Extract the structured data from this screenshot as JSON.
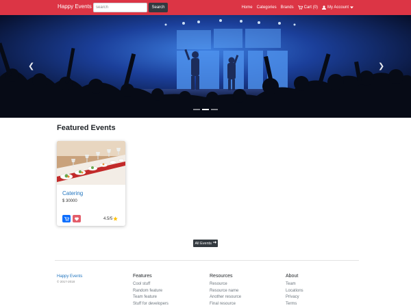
{
  "navbar": {
    "brand": "Happy Events",
    "search_placeholder": "search",
    "search_button": "Search",
    "links": {
      "home": "Home",
      "categories": "Categories",
      "brands": "Brands",
      "cart": "Cart (0)",
      "account": "My Account"
    }
  },
  "hero": {
    "slides": 3,
    "active_slide": 2
  },
  "featured": {
    "title": "Featured Events",
    "cards": [
      {
        "name": "Catering",
        "price": "$ 30000",
        "rating": "4.5/5"
      }
    ],
    "all_events_label": "All Events"
  },
  "footer": {
    "brand": "Happy Events",
    "copyright": "© 2017-2018",
    "columns": [
      {
        "title": "Features",
        "links": [
          "Cool stuff",
          "Random feature",
          "Team feature",
          "Stuff for developers"
        ]
      },
      {
        "title": "Resources",
        "links": [
          "Resource",
          "Resource name",
          "Another resource",
          "Final resource"
        ]
      },
      {
        "title": "About",
        "links": [
          "Team",
          "Locations",
          "Privacy",
          "Terms"
        ]
      }
    ]
  },
  "colors": {
    "navbar": "#dc3545",
    "dark_button": "#343a40",
    "link_blue": "#1e73be",
    "cart_button": "#0d6efd",
    "fav_button": "#e35d6a",
    "star": "#ffc107"
  }
}
